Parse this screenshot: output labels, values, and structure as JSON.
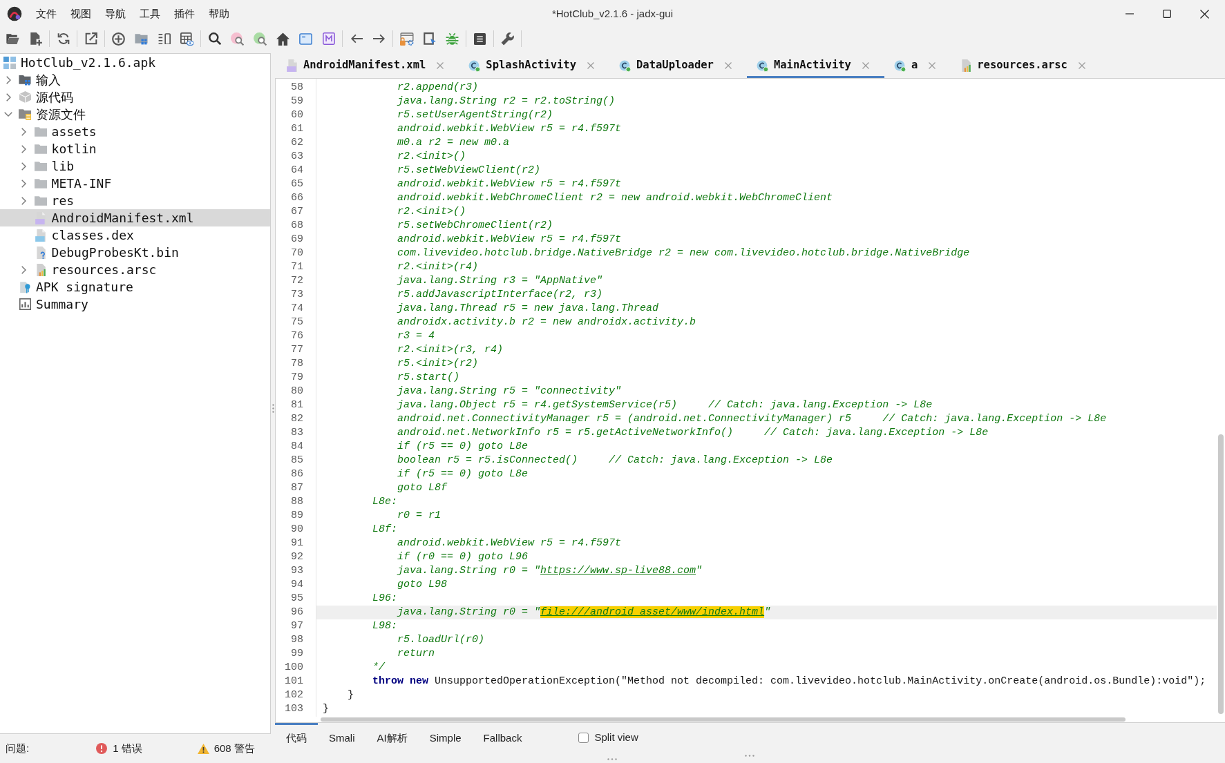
{
  "window": {
    "title": "*HotClub_v2.1.6 - jadx-gui"
  },
  "menu": [
    "文件",
    "视图",
    "导航",
    "工具",
    "插件",
    "帮助"
  ],
  "tree": {
    "root": {
      "label": "HotClub_v2.1.6.apk",
      "kind": "apk",
      "selected": false,
      "children": [
        {
          "label": "输入",
          "kind": "input",
          "expanded": false,
          "selected": false
        },
        {
          "label": "源代码",
          "kind": "package",
          "expanded": false,
          "selected": false
        },
        {
          "label": "资源文件",
          "kind": "resources",
          "expanded": true,
          "selected": false,
          "children": [
            {
              "label": "assets",
              "kind": "folder",
              "expanded": false,
              "selected": false
            },
            {
              "label": "kotlin",
              "kind": "folder",
              "expanded": false,
              "selected": false
            },
            {
              "label": "lib",
              "kind": "folder",
              "expanded": false,
              "selected": false
            },
            {
              "label": "META-INF",
              "kind": "folder",
              "expanded": false,
              "selected": false
            },
            {
              "label": "res",
              "kind": "folder",
              "expanded": false,
              "selected": false
            },
            {
              "label": "AndroidManifest.xml",
              "kind": "manifest",
              "selected": true
            },
            {
              "label": "classes.dex",
              "kind": "dex",
              "selected": false
            },
            {
              "label": "DebugProbesKt.bin",
              "kind": "unknown",
              "selected": false
            },
            {
              "label": "resources.arsc",
              "kind": "arsc",
              "expanded": false,
              "selected": false
            }
          ]
        },
        {
          "label": "APK signature",
          "kind": "signature",
          "selected": false
        },
        {
          "label": "Summary",
          "kind": "summary",
          "selected": false
        }
      ]
    }
  },
  "tabs": [
    {
      "label": "AndroidManifest.xml",
      "kind": "manifest",
      "selected": false
    },
    {
      "label": "SplashActivity",
      "kind": "class",
      "selected": false
    },
    {
      "label": "DataUploader",
      "kind": "class",
      "selected": false
    },
    {
      "label": "MainActivity",
      "kind": "class",
      "selected": true
    },
    {
      "label": "a",
      "kind": "class",
      "selected": false
    },
    {
      "label": "resources.arsc",
      "kind": "arsc",
      "selected": false
    }
  ],
  "code": {
    "lines": [
      {
        "number": "58",
        "kind": "comment",
        "current": false,
        "text": "            r2.append(r3)"
      },
      {
        "number": "59",
        "kind": "comment",
        "current": false,
        "text": "            java.lang.String r2 = r2.toString()"
      },
      {
        "number": "60",
        "kind": "comment",
        "current": false,
        "text": "            r5.setUserAgentString(r2)"
      },
      {
        "number": "61",
        "kind": "comment",
        "current": false,
        "text": "            android.webkit.WebView r5 = r4.f597t"
      },
      {
        "number": "62",
        "kind": "comment",
        "current": false,
        "text": "            m0.a r2 = new m0.a"
      },
      {
        "number": "63",
        "kind": "comment",
        "current": false,
        "text": "            r2.<init>()"
      },
      {
        "number": "64",
        "kind": "comment",
        "current": false,
        "text": "            r5.setWebViewClient(r2)"
      },
      {
        "number": "65",
        "kind": "comment",
        "current": false,
        "text": "            android.webkit.WebView r5 = r4.f597t"
      },
      {
        "number": "66",
        "kind": "comment",
        "current": false,
        "text": "            android.webkit.WebChromeClient r2 = new android.webkit.WebChromeClient"
      },
      {
        "number": "67",
        "kind": "comment",
        "current": false,
        "text": "            r2.<init>()"
      },
      {
        "number": "68",
        "kind": "comment",
        "current": false,
        "text": "            r5.setWebChromeClient(r2)"
      },
      {
        "number": "69",
        "kind": "comment",
        "current": false,
        "text": "            android.webkit.WebView r5 = r4.f597t"
      },
      {
        "number": "70",
        "kind": "comment",
        "current": false,
        "text": "            com.livevideo.hotclub.bridge.NativeBridge r2 = new com.livevideo.hotclub.bridge.NativeBridge"
      },
      {
        "number": "71",
        "kind": "comment",
        "current": false,
        "text": "            r2.<init>(r4)"
      },
      {
        "number": "72",
        "kind": "comment",
        "current": false,
        "text": "            java.lang.String r3 = \"AppNative\""
      },
      {
        "number": "73",
        "kind": "comment",
        "current": false,
        "text": "            r5.addJavascriptInterface(r2, r3)"
      },
      {
        "number": "74",
        "kind": "comment",
        "current": false,
        "text": "            java.lang.Thread r5 = new java.lang.Thread"
      },
      {
        "number": "75",
        "kind": "comment",
        "current": false,
        "text": "            androidx.activity.b r2 = new androidx.activity.b"
      },
      {
        "number": "76",
        "kind": "comment",
        "current": false,
        "text": "            r3 = 4"
      },
      {
        "number": "77",
        "kind": "comment",
        "current": false,
        "text": "            r2.<init>(r3, r4)"
      },
      {
        "number": "78",
        "kind": "comment",
        "current": false,
        "text": "            r5.<init>(r2)"
      },
      {
        "number": "79",
        "kind": "comment",
        "current": false,
        "text": "            r5.start()"
      },
      {
        "number": "80",
        "kind": "comment",
        "current": false,
        "text": "            java.lang.String r5 = \"connectivity\""
      },
      {
        "number": "81",
        "kind": "comment",
        "current": false,
        "text": "            java.lang.Object r5 = r4.getSystemService(r5)     // Catch: java.lang.Exception -> L8e"
      },
      {
        "number": "82",
        "kind": "comment",
        "current": false,
        "text": "            android.net.ConnectivityManager r5 = (android.net.ConnectivityManager) r5     // Catch: java.lang.Exception -> L8e"
      },
      {
        "number": "83",
        "kind": "comment",
        "current": false,
        "text": "            android.net.NetworkInfo r5 = r5.getActiveNetworkInfo()     // Catch: java.lang.Exception -> L8e"
      },
      {
        "number": "84",
        "kind": "comment",
        "current": false,
        "text": "            if (r5 == 0) goto L8e"
      },
      {
        "number": "85",
        "kind": "comment",
        "current": false,
        "text": "            boolean r5 = r5.isConnected()     // Catch: java.lang.Exception -> L8e"
      },
      {
        "number": "86",
        "kind": "comment",
        "current": false,
        "text": "            if (r5 == 0) goto L8e"
      },
      {
        "number": "87",
        "kind": "comment",
        "current": false,
        "text": "            goto L8f"
      },
      {
        "number": "88",
        "kind": "comment",
        "current": false,
        "text": "        L8e:"
      },
      {
        "number": "89",
        "kind": "comment",
        "current": false,
        "text": "            r0 = r1"
      },
      {
        "number": "90",
        "kind": "comment",
        "current": false,
        "text": "        L8f:"
      },
      {
        "number": "91",
        "kind": "comment",
        "current": false,
        "text": "            android.webkit.WebView r5 = r4.f597t"
      },
      {
        "number": "92",
        "kind": "comment",
        "current": false,
        "text": "            if (r0 == 0) goto L96"
      },
      {
        "number": "93",
        "kind": "comment",
        "current": false,
        "parts": [
          {
            "text": "            java.lang.String r0 = \""
          },
          {
            "text": "https://www.sp-live88.com",
            "kind": "link",
            "highlighted": false
          },
          {
            "text": "\""
          }
        ]
      },
      {
        "number": "94",
        "kind": "comment",
        "current": false,
        "text": "            goto L98"
      },
      {
        "number": "95",
        "kind": "comment",
        "current": false,
        "text": "        L96:"
      },
      {
        "number": "96",
        "kind": "comment",
        "current": true,
        "parts": [
          {
            "text": "            java.lang.String r0 = \""
          },
          {
            "text": "file:///android_asset/www/index.html",
            "kind": "link",
            "highlighted": true
          },
          {
            "text": "\""
          }
        ]
      },
      {
        "number": "97",
        "kind": "comment",
        "current": false,
        "text": "        L98:"
      },
      {
        "number": "98",
        "kind": "comment",
        "current": false,
        "text": "            r5.loadUrl(r0)"
      },
      {
        "number": "99",
        "kind": "comment",
        "current": false,
        "text": "            return"
      },
      {
        "number": "100",
        "kind": "comment",
        "current": false,
        "text": "        */"
      },
      {
        "number": "101",
        "kind": "code",
        "current": false,
        "text": "        **throw new** UnsupportedOperationException(\"Method not decompiled: com.livevideo.hotclub.MainActivity.onCreate(android.os.Bundle):void\");"
      },
      {
        "number": "102",
        "kind": "code",
        "current": false,
        "text": "    }"
      },
      {
        "number": "103",
        "kind": "code",
        "current": false,
        "text": "}"
      }
    ]
  },
  "view_tabs": [
    {
      "label": "代码",
      "selected": true
    },
    {
      "label": "Smali",
      "selected": false
    },
    {
      "label": "AI解析",
      "selected": false
    },
    {
      "label": "Simple",
      "selected": false
    },
    {
      "label": "Fallback",
      "selected": false
    }
  ],
  "split_view": {
    "label": "Split view",
    "checked": false
  },
  "status_bar": {
    "label": "问题:",
    "errors": "1 错误",
    "warnings": "608 警告"
  }
}
